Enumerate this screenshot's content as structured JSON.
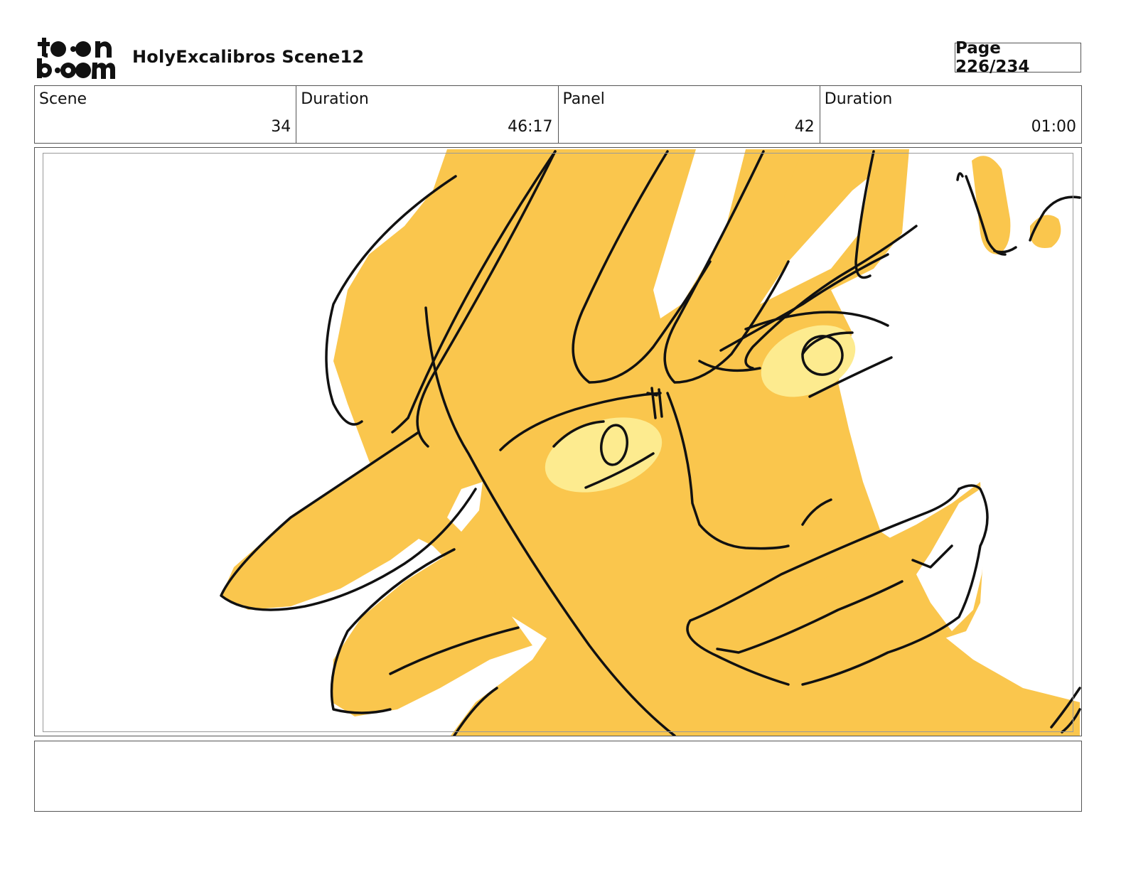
{
  "header": {
    "logo_text": "toon boom",
    "title": "HolyExcalibros Scene12",
    "page_label": "Page 226/234"
  },
  "info": {
    "scene_label": "Scene",
    "scene_value": "34",
    "duration_label": "Duration",
    "duration_value": "46:17",
    "panel_label": "Panel",
    "panel_value": "42",
    "panel_duration_label": "Duration",
    "panel_duration_value": "01:00"
  },
  "panel": {
    "fill_color": "#FAC64D",
    "highlight_color": "#FDEB8F",
    "line_color": "#111111"
  },
  "notes": {
    "text": ""
  }
}
